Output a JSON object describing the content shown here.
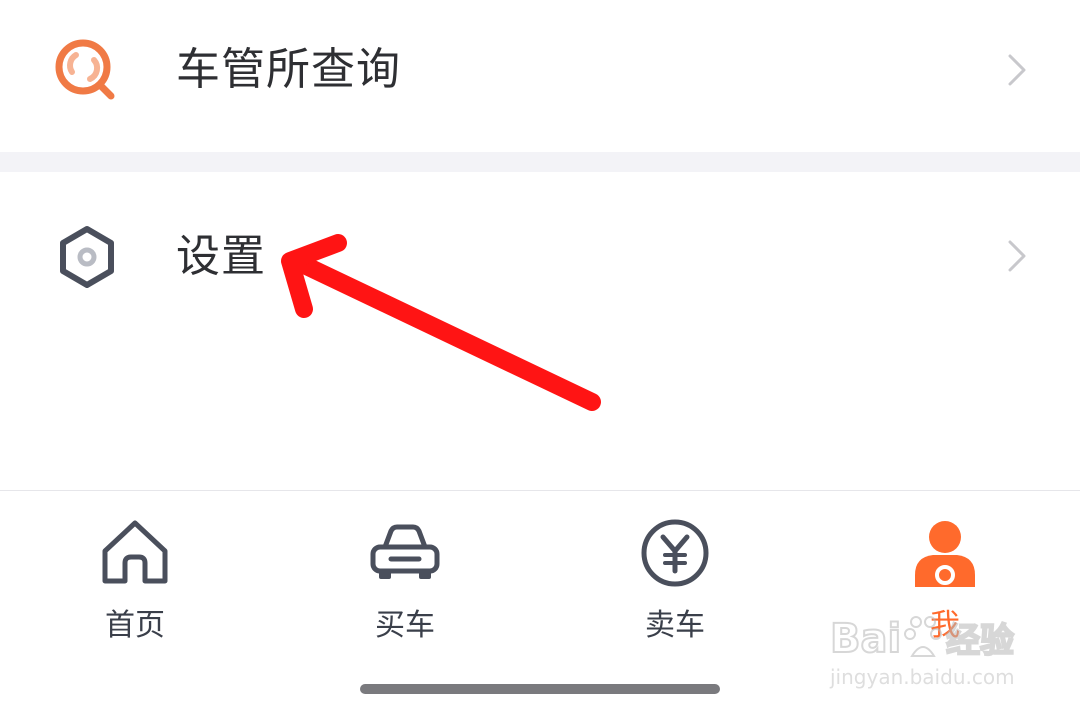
{
  "menu": {
    "items": [
      {
        "label": "车管所查询",
        "icon": "search-icon"
      },
      {
        "label": "设置",
        "icon": "gear-icon"
      }
    ]
  },
  "tabbar": {
    "tabs": [
      {
        "label": "首页",
        "icon": "home-icon"
      },
      {
        "label": "买车",
        "icon": "car-icon"
      },
      {
        "label": "卖车",
        "icon": "yen-icon"
      },
      {
        "label": "我",
        "icon": "user-icon",
        "active": true
      }
    ]
  },
  "watermark": {
    "brand": "Baidu经验",
    "url": "jingyan.baidu.com"
  },
  "colors": {
    "accent": "#ff6a2c",
    "annotation": "#ff1414",
    "text": "#2e2f33",
    "icon_gray": "#4a4f5c",
    "divider_bg": "#f3f3f7"
  }
}
